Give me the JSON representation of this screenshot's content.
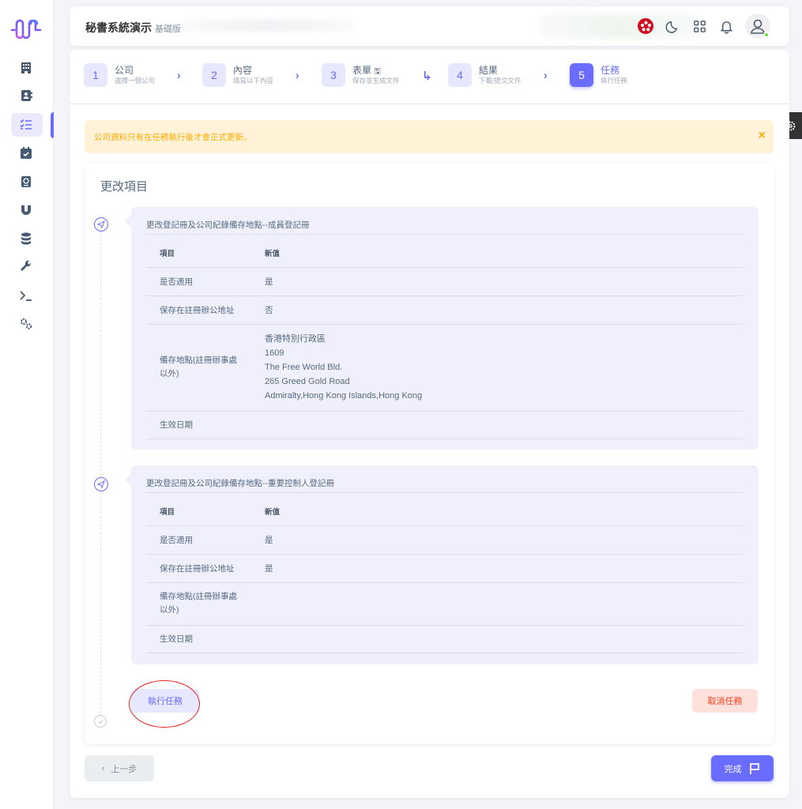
{
  "brand_color": "#696cff",
  "header": {
    "title": "秘書系統演示",
    "edition": "基礎版",
    "icons": [
      "hong-kong-flag-icon",
      "moon-icon",
      "grid-icon",
      "bell-icon",
      "user-icon"
    ]
  },
  "sidebar": {
    "items": [
      {
        "icon": "building-icon"
      },
      {
        "icon": "contact-book-icon"
      },
      {
        "icon": "checklist-icon",
        "active": true
      },
      {
        "icon": "calendar-check-icon"
      },
      {
        "icon": "passport-icon"
      },
      {
        "icon": "magnet-icon"
      },
      {
        "icon": "database-icon"
      },
      {
        "icon": "wrench-icon"
      },
      {
        "icon": "terminal-icon"
      },
      {
        "icon": "settings-icon"
      }
    ]
  },
  "stepper": {
    "steps": [
      {
        "num": "1",
        "title": "公司",
        "sub": "選擇一個公司"
      },
      {
        "num": "2",
        "title": "內容",
        "sub": "填寫以下內容"
      },
      {
        "num": "3",
        "title": "表單",
        "sub": "保存並生成文件"
      },
      {
        "num": "4",
        "title": "結果",
        "sub": "下載/提交文件"
      },
      {
        "num": "5",
        "title": "任務",
        "sub": "執行任務",
        "active": true
      }
    ]
  },
  "alert": {
    "text": "公司資料只有在任務執行後才會正式更新。",
    "close": "×"
  },
  "changes": {
    "title": "更改項目",
    "panels": [
      {
        "title": "更改登記冊及公司紀錄備存地點--成員登記冊",
        "header": {
          "item": "項目",
          "value": "新值"
        },
        "rows": [
          {
            "item": "是否適用",
            "value": [
              "是"
            ]
          },
          {
            "item": "保存在註冊辦公地址",
            "value": [
              "否"
            ]
          },
          {
            "item": "備存地點(註冊辦事處以外)",
            "value": [
              "香港特別行政區",
              "1609",
              "The Free World Bld.",
              "265 Greed Gold Road",
              "Admiralty,Hong Kong Islands,Hong Kong"
            ]
          },
          {
            "item": "生效日期",
            "value": []
          }
        ]
      },
      {
        "title": "更改登記冊及公司紀錄備存地點--重要控制人登記冊",
        "header": {
          "item": "項目",
          "value": "新值"
        },
        "rows": [
          {
            "item": "是否適用",
            "value": [
              "是"
            ]
          },
          {
            "item": "保存在註冊辦公地址",
            "value": [
              "是"
            ]
          },
          {
            "item": "備存地點(註冊辦事處以外)",
            "value": []
          },
          {
            "item": "生效日期",
            "value": []
          }
        ]
      }
    ],
    "execute_label": "執行任務",
    "cancel_label": "取消任務"
  },
  "footer": {
    "prev_label": "上一步",
    "finish_label": "完成"
  }
}
